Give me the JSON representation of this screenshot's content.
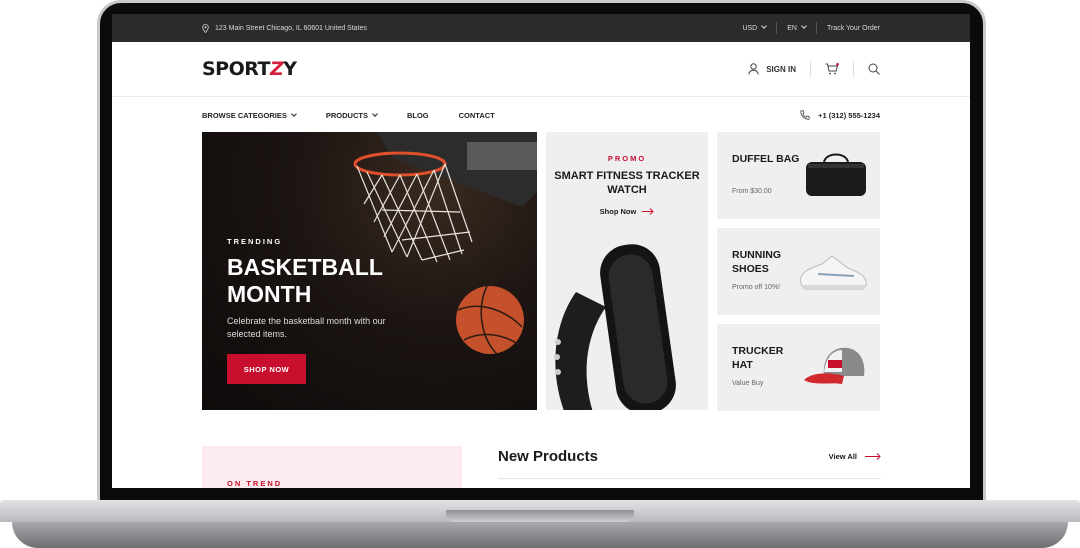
{
  "topbar": {
    "address": "123 Main Street Chicago, IL 60601 United States",
    "currency": "USD",
    "language": "EN",
    "track_order": "Track Your Order"
  },
  "header": {
    "logo_left": "SPORT",
    "logo_z": "Z",
    "logo_right": "Y",
    "sign_in": "SIGN IN"
  },
  "nav": {
    "items": [
      "BROWSE CATEGORIES",
      "PRODUCTS",
      "BLOG",
      "CONTACT"
    ],
    "phone": "+1 (312) 555-1234"
  },
  "hero": {
    "tag": "TRENDING",
    "title": "BASKETBALL MONTH",
    "description": "Celebrate the basketball month with our selected items.",
    "button": "SHOP NOW"
  },
  "promo": {
    "tag": "PROMO",
    "title": "SMART FITNESS TRACKER WATCH",
    "shop": "Shop Now"
  },
  "tiles": [
    {
      "name": "DUFFEL BAG",
      "subtitle": "From $30.00"
    },
    {
      "name": "RUNNING SHOES",
      "subtitle": "Promo off 10%!"
    },
    {
      "name": "TRUCKER HAT",
      "subtitle": "Value Buy"
    }
  ],
  "bottom": {
    "on_trend": "ON TREND",
    "new_products": "New Products",
    "view_all": "View All"
  },
  "colors": {
    "accent": "#c8102e",
    "topbar": "#2b2b2b",
    "tile_bg": "#efefef"
  }
}
